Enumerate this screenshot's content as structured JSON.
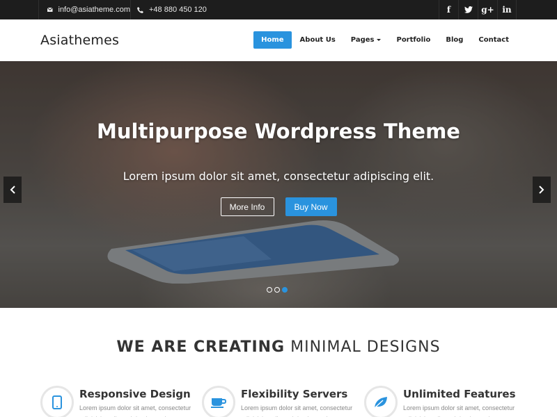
{
  "topbar": {
    "email": "info@asiatheme.com",
    "phone": "+48 880 450 120",
    "social": [
      {
        "icon": "facebook-icon",
        "glyph": "f"
      },
      {
        "icon": "twitter-icon",
        "glyph": "t"
      },
      {
        "icon": "google-plus-icon",
        "glyph": "g+"
      },
      {
        "icon": "linkedin-icon",
        "glyph": "in"
      }
    ]
  },
  "header": {
    "logo": "Asiathemes",
    "nav": [
      {
        "label": "Home",
        "active": true
      },
      {
        "label": "About Us"
      },
      {
        "label": "Pages",
        "dropdown": true
      },
      {
        "label": "Portfolio"
      },
      {
        "label": "Blog"
      },
      {
        "label": "Contact"
      }
    ]
  },
  "hero": {
    "title": "Multipurpose Wordpress Theme",
    "subtitle": "Lorem ipsum dolor sit amet, consectetur adipiscing elit.",
    "more_info_label": "More Info",
    "buy_now_label": "Buy Now",
    "slides_count": 3,
    "active_slide": 3
  },
  "section": {
    "title_bold": "WE ARE CREATING",
    "title_light": "MINIMAL DESIGNS"
  },
  "features": [
    {
      "title": "Responsive Design",
      "text": "Lorem ipsum dolor sit amet, consectetur adipisicing elit, sed do eiusmod tempor",
      "icon": "tablet-icon"
    },
    {
      "title": "Flexibility Servers",
      "text": "Lorem ipsum dolor sit amet, consectetur adipisicing elit, sed do eiusmod tempor",
      "icon": "coffee-cup-icon"
    },
    {
      "title": "Unlimited Features",
      "text": "Lorem ipsum dolor sit amet, consectetur adipisicing elit, sed do eiusmod tempor",
      "icon": "leaf-icon"
    }
  ],
  "colors": {
    "accent": "#2a93de",
    "topbar": "#1d1d1d"
  }
}
